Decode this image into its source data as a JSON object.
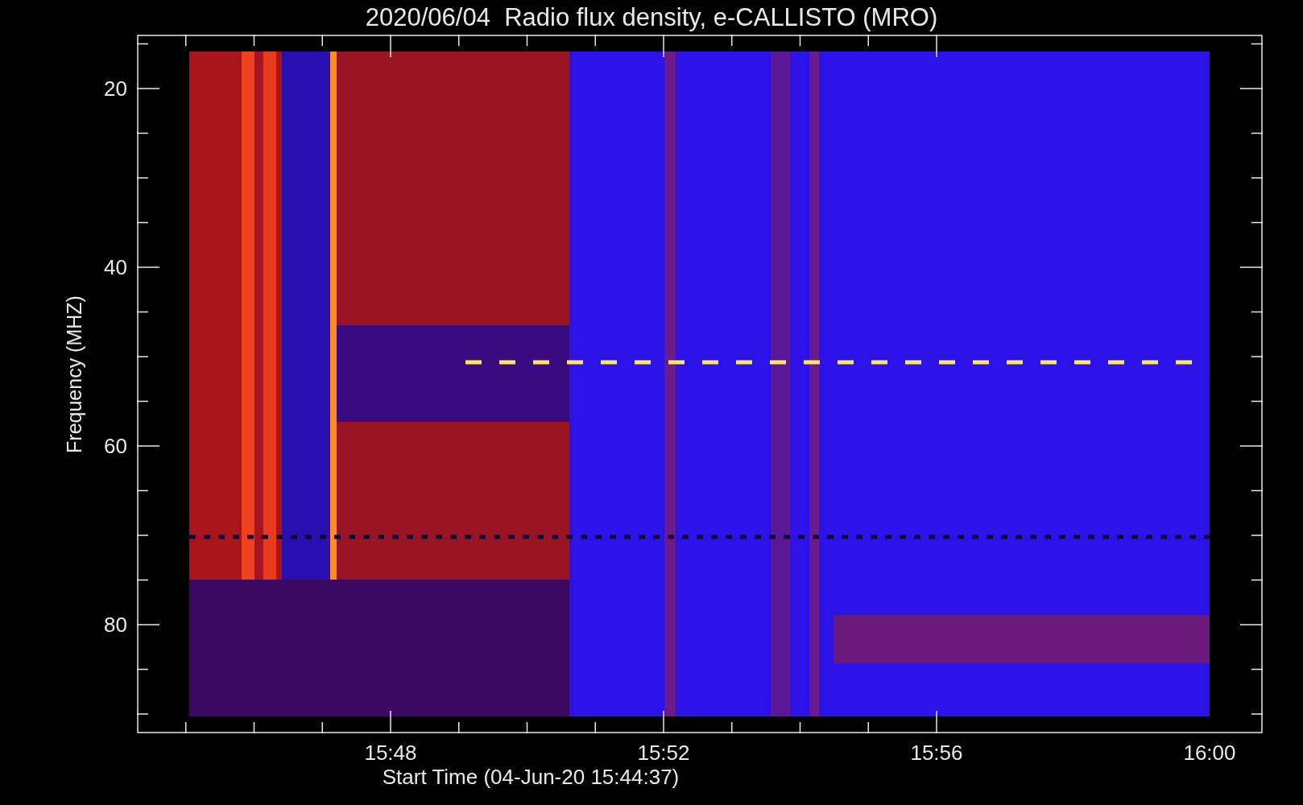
{
  "title": "2020/06/04  Radio flux density, e-CALLISTO (MRO)",
  "y_axis": {
    "label": "Frequency (MHZ)",
    "ticks": [
      "20",
      "40",
      "60",
      "80"
    ]
  },
  "x_axis": {
    "label": "Start Time (04-Jun-20 15:44:37)",
    "ticks": [
      "15:48",
      "15:52",
      "15:56",
      "16:00"
    ]
  }
}
